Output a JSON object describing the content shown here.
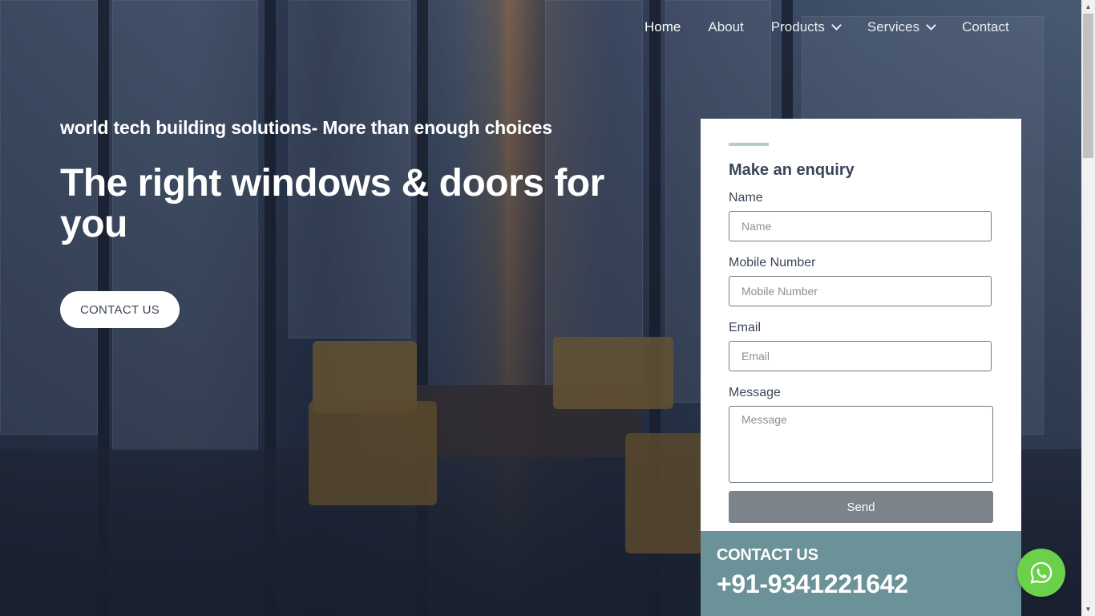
{
  "nav": {
    "items": [
      {
        "label": "Home",
        "has_dropdown": false,
        "active": true
      },
      {
        "label": "About",
        "has_dropdown": false,
        "active": false
      },
      {
        "label": "Products",
        "has_dropdown": true,
        "active": false
      },
      {
        "label": "Services",
        "has_dropdown": true,
        "active": false
      },
      {
        "label": "Contact",
        "has_dropdown": false,
        "active": false
      }
    ]
  },
  "hero": {
    "tagline": "world tech building solutions- More than enough choices",
    "title": "The right windows & doors for you",
    "cta_label": "CONTACT US"
  },
  "enquiry": {
    "title": "Make an enquiry",
    "fields": {
      "name": {
        "label": "Name",
        "placeholder": "Name",
        "value": ""
      },
      "mobile": {
        "label": "Mobile Number",
        "placeholder": "Mobile Number",
        "value": ""
      },
      "email": {
        "label": "Email",
        "placeholder": "Email",
        "value": ""
      },
      "message": {
        "label": "Message",
        "placeholder": "Message",
        "value": ""
      }
    },
    "send_label": "Send"
  },
  "contact": {
    "label": "CONTACT US",
    "phone": "+91-9341221642"
  },
  "icons": {
    "whatsapp": "whatsapp-icon",
    "dropdown": "chevron-down-icon"
  },
  "colors": {
    "accent_teal": "#6b9299",
    "send_button": "#7d838b",
    "whatsapp_green": "#6bd04a",
    "text_dark": "#3a4658"
  }
}
